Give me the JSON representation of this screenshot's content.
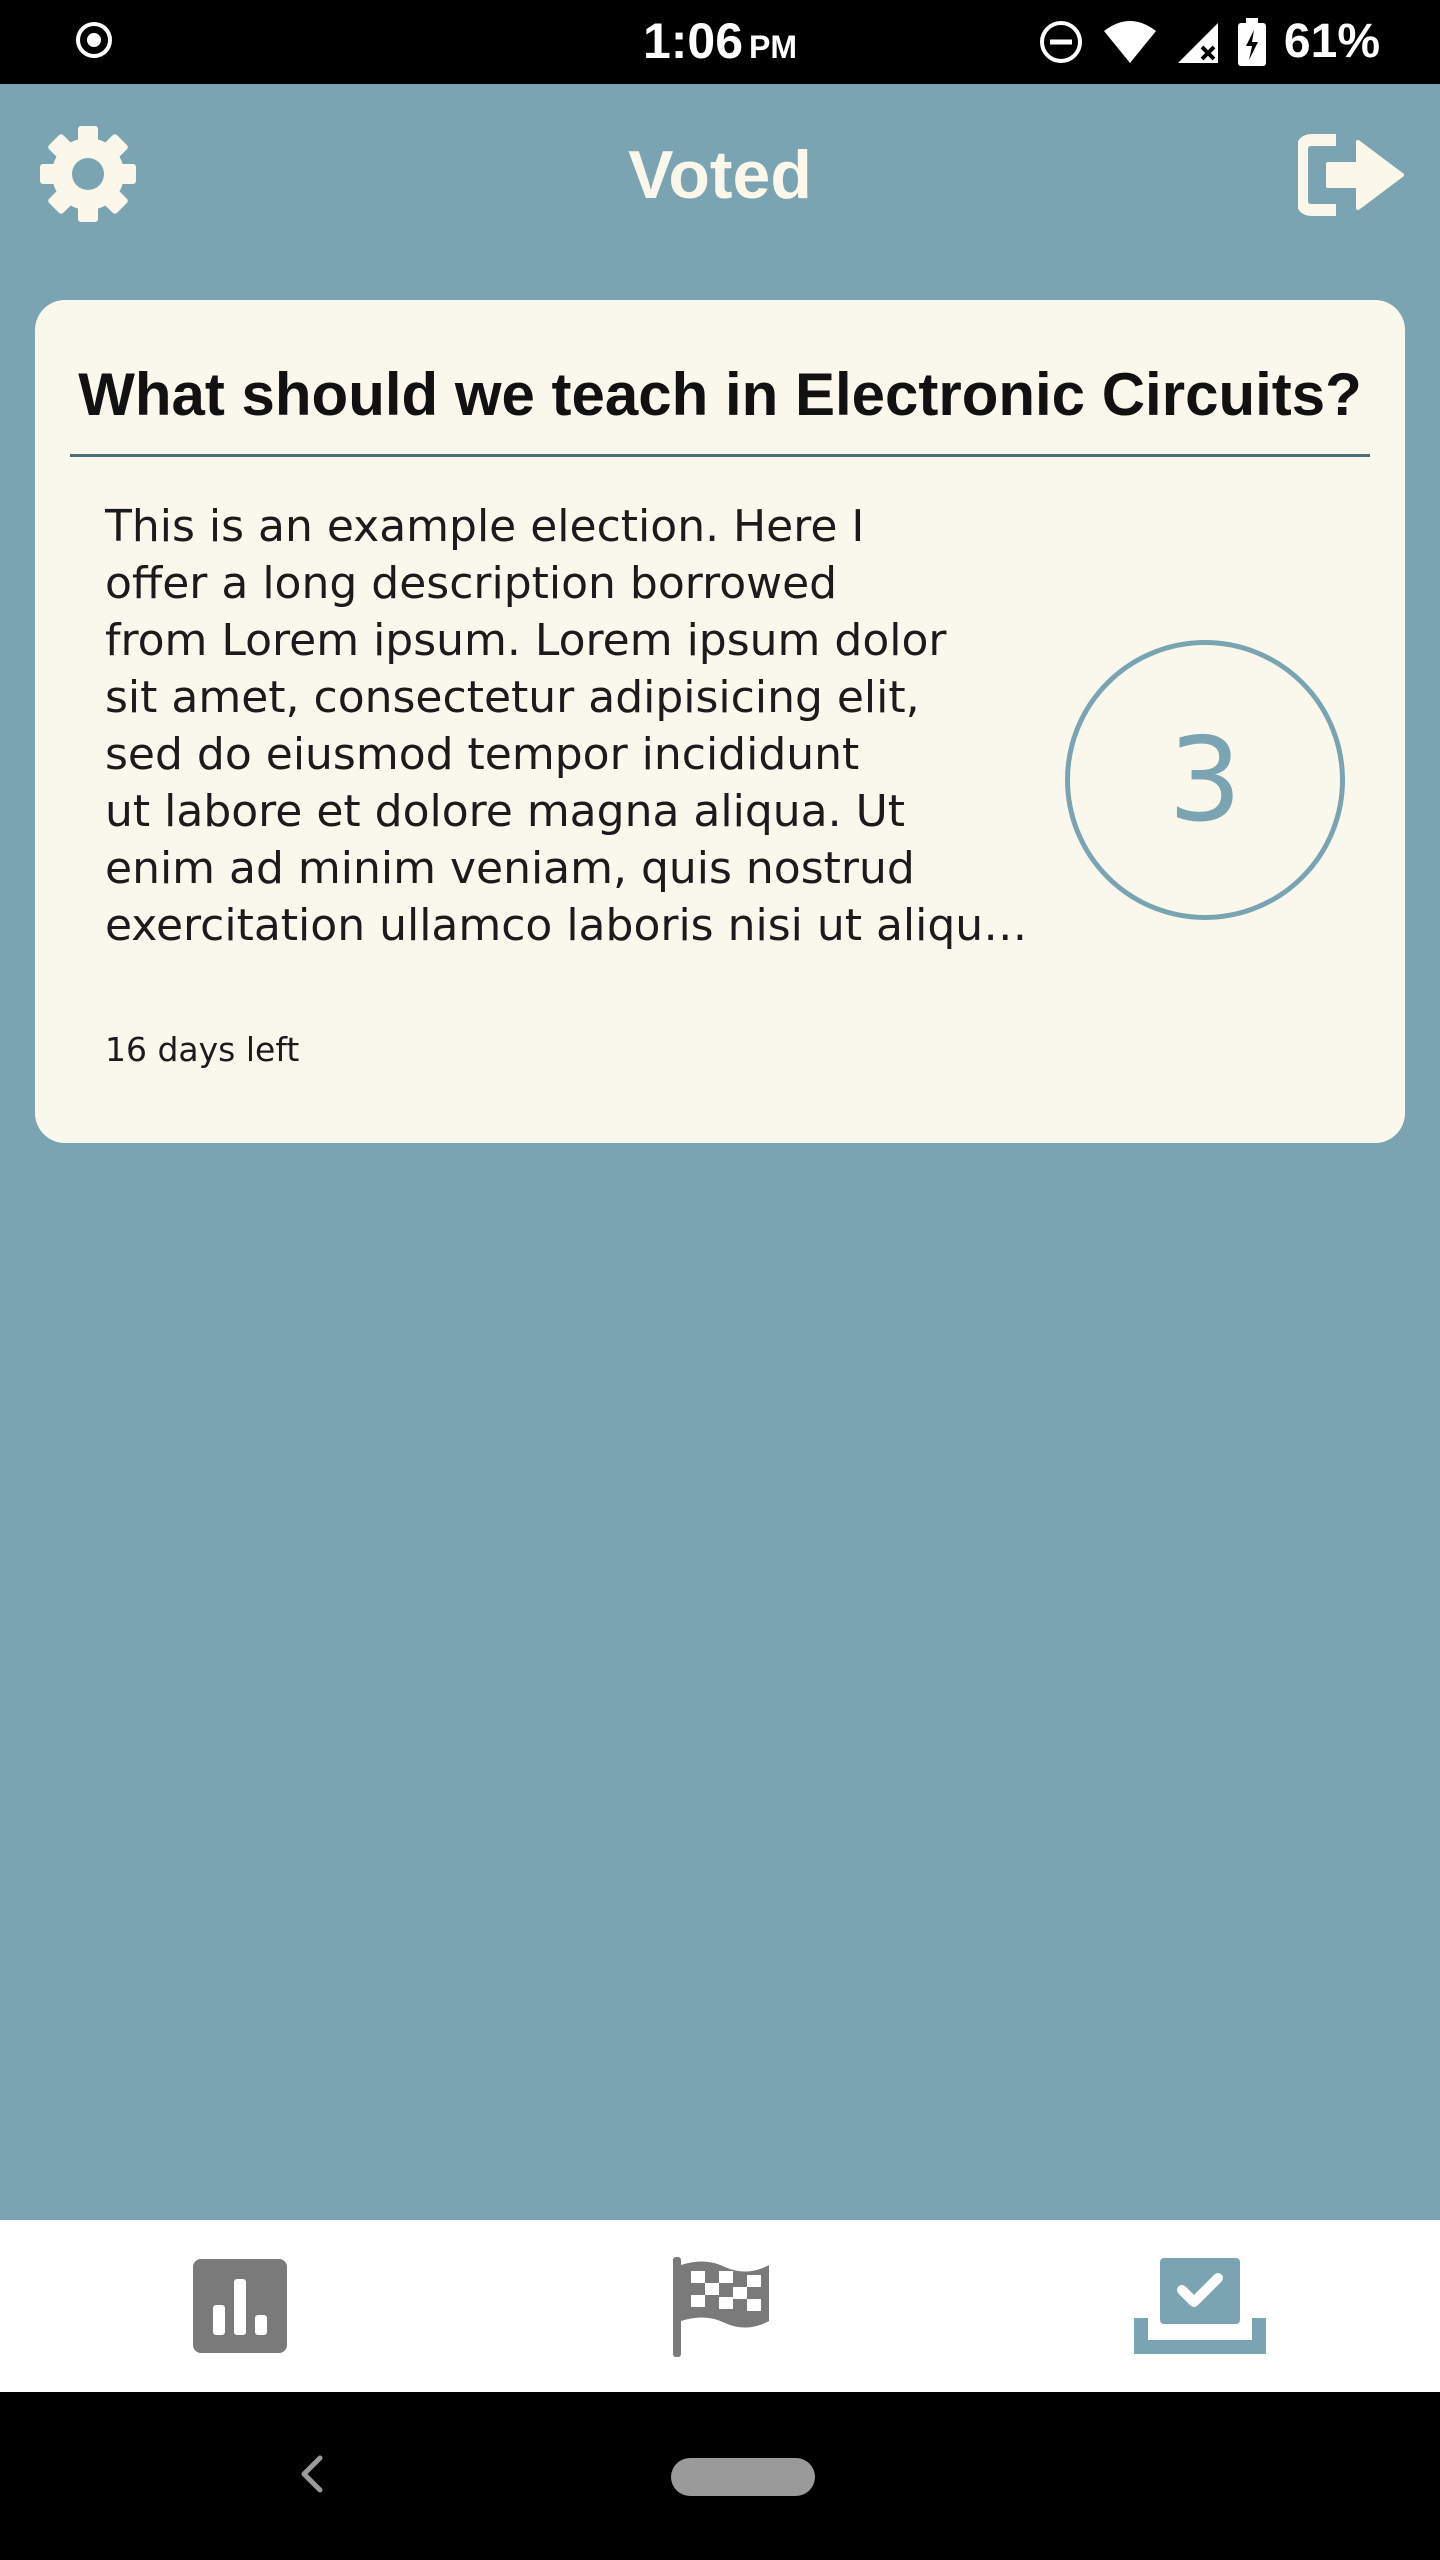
{
  "status_bar": {
    "time": "1:06",
    "ampm": "PM",
    "battery_percent": "61%",
    "icons": [
      "record-icon",
      "do-not-disturb-icon",
      "wifi-icon",
      "signal-icon",
      "battery-charging-icon"
    ]
  },
  "header": {
    "title": "Voted",
    "left_icon": "gear-icon",
    "right_icon": "logout-icon"
  },
  "election": {
    "title": "What should we teach in Electronic Circuits?",
    "description_lines": [
      "This is an example election. Here I",
      "offer a long description borrowed",
      "from Lorem ipsum. Lorem ipsum dolor",
      "sit amet, consectetur adipisicing elit,",
      "sed do eiusmod tempor incididunt",
      "ut labore et dolore magna aliqua. Ut",
      "enim ad minim veniam, quis nostrud",
      "exercitation ullamco laboris nisi ut aliqu…"
    ],
    "vote_count": "3",
    "days_left": "16 days left"
  },
  "tabs": [
    {
      "icon": "bar-chart-icon",
      "active": false
    },
    {
      "icon": "checkered-flag-icon",
      "active": false
    },
    {
      "icon": "ballot-box-check-icon",
      "active": true
    }
  ],
  "colors": {
    "background": "#7aa4b1",
    "card": "#faf7ec",
    "header_text": "#fbf7ea",
    "tab_inactive": "#7a7a7a",
    "tab_active": "#7aa4b1"
  }
}
